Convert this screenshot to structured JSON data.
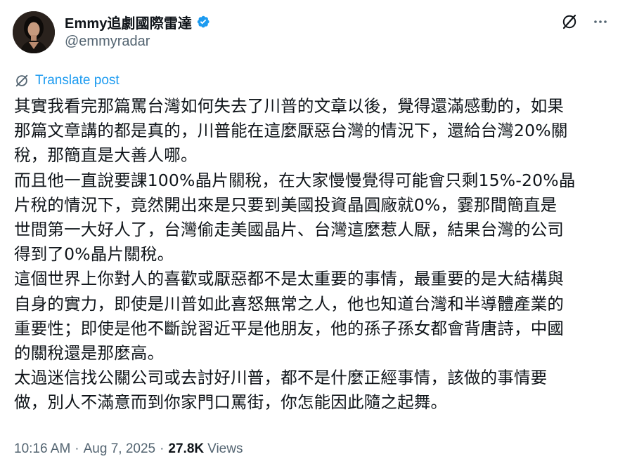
{
  "author": {
    "display_name": "Emmy追劇國際雷達",
    "handle": "@emmyradar",
    "verified": true
  },
  "actions": {
    "grok_icon": "grok-icon",
    "more_icon": "more-icon"
  },
  "translate": {
    "label": "Translate post",
    "icon": "translate-icon"
  },
  "post": {
    "lines": [
      "其實我看完那篇罵台灣如何失去了川普的文章以後，覺得還滿感動的，如果",
      "那篇文章講的都是真的，川普能在這麼厭惡台灣的情況下，還給台灣20%關",
      "稅，那簡直是大善人哪。",
      "而且他一直說要課100%晶片關稅，在大家慢慢覺得可能會只剩15%-20%晶",
      "片稅的情況下，竟然開出來是只要到美國投資晶圓廠就0%，霎那間簡直是",
      "世間第一大好人了，台灣偷走美國晶片、台灣這麼惹人厭，結果台灣的公司",
      "得到了0%晶片關稅。",
      "這個世界上你對人的喜歡或厭惡都不是太重要的事情，最重要的是大結構與",
      "自身的實力，即使是川普如此喜怒無常之人，他也知道台灣和半導體產業的",
      "重要性；即使是他不斷說習近平是他朋友，他的孫子孫女都會背唐詩，中國",
      "的關稅還是那麼高。",
      "太過迷信找公關公司或去討好川普，都不是什麼正經事情，該做的事情要",
      "做，別人不滿意而到你家門口罵街，你怎能因此隨之起舞。"
    ]
  },
  "meta": {
    "time": "10:16 AM",
    "separator": "·",
    "date": "Aug 7, 2025",
    "views_count": "27.8K",
    "views_label": "Views"
  },
  "colors": {
    "accent": "#1d9bf0",
    "text": "#0f1419",
    "secondary": "#536471"
  }
}
